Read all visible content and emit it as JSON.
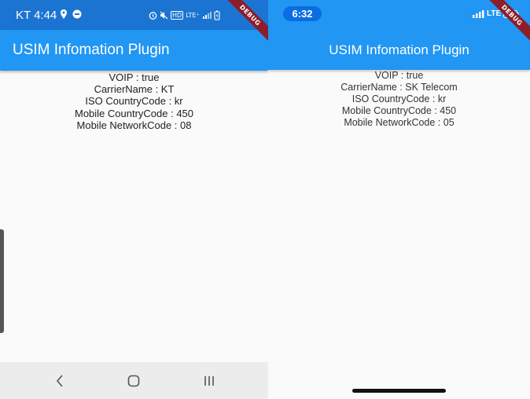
{
  "android": {
    "status": {
      "carrier_time": "KT 4:44",
      "lte": "LTE⁺"
    },
    "app_title": "USIM Infomation Plugin",
    "debug_label": "DEBUG",
    "info": [
      "VOIP : true",
      "CarrierName : KT",
      "ISO CountryCode : kr",
      "Mobile CountryCode : 450",
      "Mobile NetworkCode : 08"
    ],
    "nav": {
      "back_icon": "back-icon",
      "home_icon": "home-icon",
      "recents_icon": "recents-icon"
    }
  },
  "ios": {
    "status": {
      "time": "6:32",
      "network": "LTE"
    },
    "app_title": "USIM Infomation Plugin",
    "debug_label": "DEBUG",
    "info": [
      "VOIP : true",
      "CarrierName : SK Telecom",
      "ISO CountryCode : kr",
      "Mobile CountryCode : 450",
      "Mobile NetworkCode : 05"
    ]
  },
  "colors": {
    "primary": "#2196f3",
    "android_status": "#1b74d2",
    "debug_banner": "#8b1e2a"
  }
}
